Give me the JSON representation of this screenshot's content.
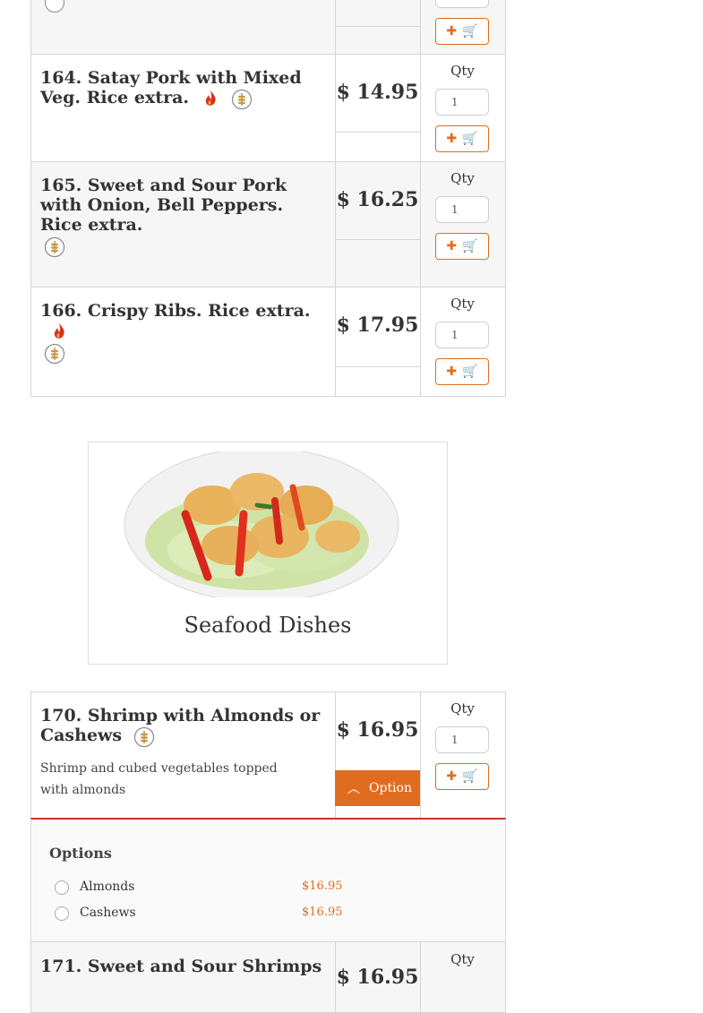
{
  "qty_label": "Qty",
  "qty_default": "1",
  "accent_color": "#e06d1f",
  "items": [
    {
      "number_title": "164. Satay Pork with Mixed Veg. Rice extra.",
      "price": "$ 14.95",
      "spicy": true,
      "gluten_free": true
    },
    {
      "number_title": "165. Sweet and Sour Pork with Onion, Bell Peppers. Rice extra.",
      "price": "$ 16.25",
      "spicy": false,
      "gluten_free": true
    },
    {
      "number_title": "166. Crispy Ribs. Rice extra.",
      "price": "$ 17.95",
      "spicy": true,
      "gluten_free": true
    }
  ],
  "category": {
    "name": "Seafood Dishes",
    "image": "fried-shrimp-with-peppers-photo"
  },
  "item_170": {
    "title": "170. Shrimp with Almonds or Cashews",
    "price": "$ 16.95",
    "description": "Shrimp and cubed vegetables topped with almonds",
    "option_button": "Option",
    "options_title": "Options",
    "options": [
      {
        "label": "Almonds",
        "price": "$16.95"
      },
      {
        "label": "Cashews",
        "price": "$16.95"
      }
    ]
  },
  "item_171": {
    "title": "171. Sweet and Sour Shrimps",
    "price": "$ 16.95"
  }
}
